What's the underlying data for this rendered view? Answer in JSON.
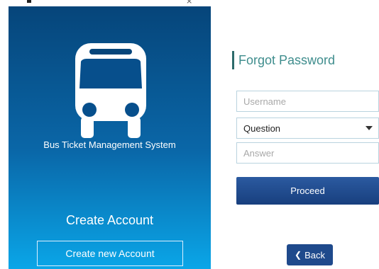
{
  "window": {
    "close_glyph": "×"
  },
  "left_panel": {
    "app_title": "Bus Ticket Management System",
    "create_heading": "Create Account",
    "create_button_label": "Create new Account",
    "logo_icon": "bus-icon"
  },
  "form": {
    "title": "Forgot Password",
    "username_placeholder": "Username",
    "question_selected": "Question",
    "answer_placeholder": "Answer",
    "proceed_label": "Proceed",
    "back_label": "Back",
    "back_icon": "chevron-left-icon"
  },
  "colors": {
    "panel_top": "#06457a",
    "panel_bottom": "#0aa6e8",
    "title_accent": "#3f8d8d",
    "button_primary": "#1f4a8c"
  }
}
